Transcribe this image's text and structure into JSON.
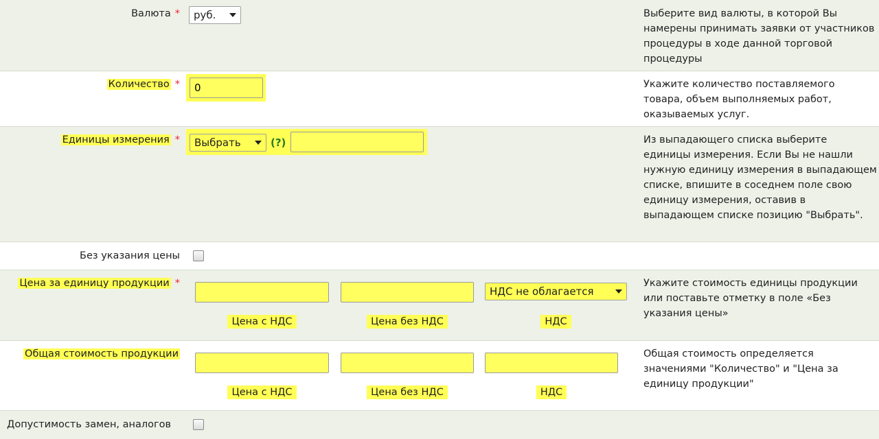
{
  "colors": {
    "highlight": "#ffff55",
    "row_shade": "#eef1e8",
    "required": "#e22233",
    "help_link": "#2a7a20"
  },
  "required_mark": "*",
  "currency": {
    "label": "Валюта",
    "value": "руб.",
    "help": "Выберите вид валюты, в которой Вы намерены принимать заявки от участников процедуры в ходе данной торговой процедуры"
  },
  "quantity": {
    "label": "Количество",
    "value": "0",
    "help": "Укажите количество поставляемого товара, объем выполняемых работ, оказываемых услуг."
  },
  "units": {
    "label": "Единицы измерения",
    "select_value": "Выбрать",
    "help_link": "(?)",
    "custom_value": "",
    "help": "Из выпадающего списка выберите единицы измерения. Если Вы не нашли нужную единицу измерения в выпадающем списке, впишите в соседнем поле свою единицу измерения, оставив в выпадающем списке позицию \"Выбрать\"."
  },
  "no_price": {
    "label": "Без указания цены",
    "checked": false
  },
  "unit_price": {
    "label": "Цена за единицу продукции",
    "with_vat_value": "",
    "without_vat_value": "",
    "vat_select": "НДС не облагается",
    "sub_with_vat": "Цена с НДС",
    "sub_without_vat": "Цена без НДС",
    "sub_vat": "НДС",
    "help": "Укажите стоимость единицы продукции или поставьте отметку в поле «Без указания цены»"
  },
  "total": {
    "label": "Общая стоимость продукции",
    "with_vat_value": "",
    "without_vat_value": "",
    "vat_value": "",
    "sub_with_vat": "Цена с НДС",
    "sub_without_vat": "Цена без НДС",
    "sub_vat": "НДС",
    "help": "Общая стоимость определяется значениями \"Количество\" и \"Цена за единицу продукции\""
  },
  "substitutes": {
    "label": "Допустимость замен, аналогов",
    "checked": false
  }
}
